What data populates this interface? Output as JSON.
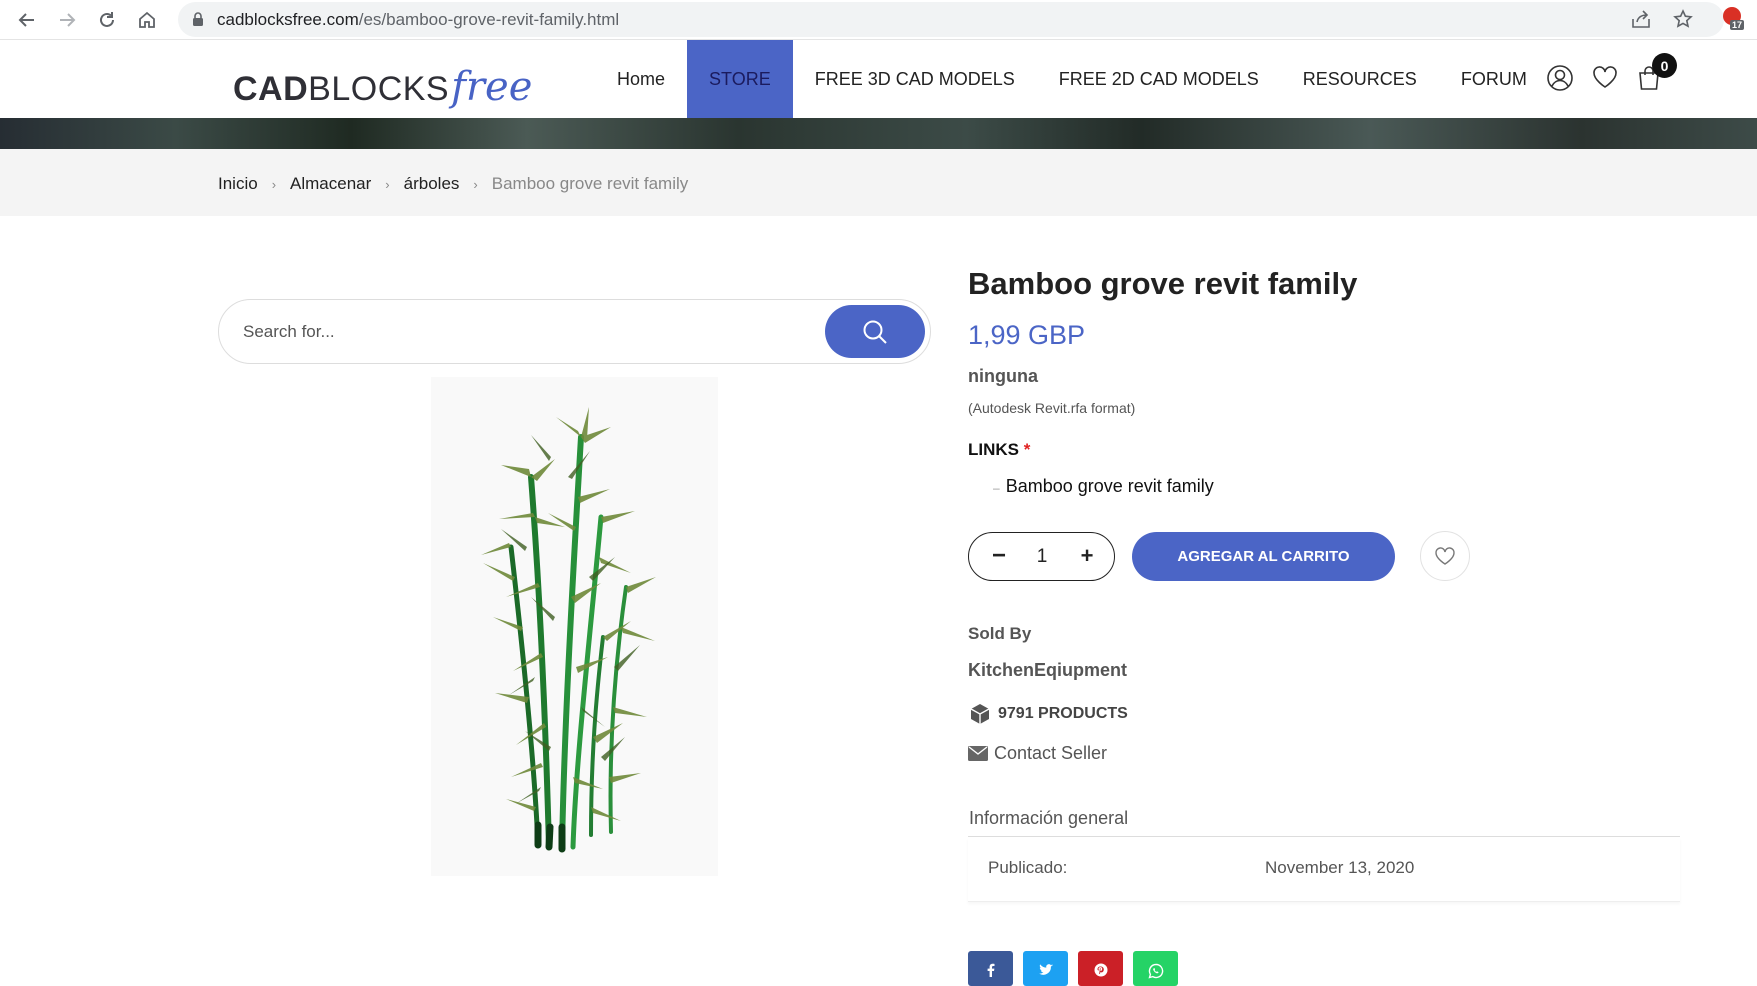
{
  "browser": {
    "url_host": "cadblocksfree.com",
    "url_path": "/es/bamboo-grove-revit-family.html",
    "extension_badge": "17"
  },
  "header": {
    "logo": {
      "bold": "CAD",
      "light": "BLOCKS",
      "script": "free"
    },
    "nav": [
      {
        "label": "Home"
      },
      {
        "label": "STORE"
      },
      {
        "label": "FREE 3D CAD MODELS"
      },
      {
        "label": "FREE 2D CAD MODELS"
      },
      {
        "label": "RESOURCES"
      },
      {
        "label": "FORUM"
      }
    ],
    "cart_count": "0"
  },
  "breadcrumb": {
    "items": [
      "Inicio",
      "Almacenar",
      "árboles"
    ],
    "current": "Bamboo grove revit family"
  },
  "search": {
    "placeholder": "Search for..."
  },
  "product": {
    "title": "Bamboo grove revit family",
    "price": "1,99 GBP",
    "brand": "ninguna",
    "format": "(Autodesk Revit.rfa format)",
    "links_label": "LINKS",
    "links_required": "*",
    "link_option": "Bamboo grove revit family",
    "quantity": "1",
    "add_to_cart": "AGREGAR AL CARRITO"
  },
  "seller": {
    "sold_by_label": "Sold By",
    "name": "KitchenEqiupment",
    "products": "9791 PRODUCTS",
    "contact": "Contact Seller"
  },
  "info": {
    "tab": "Información general",
    "rows": [
      {
        "key": "Publicado:",
        "value": "November 13, 2020"
      }
    ]
  },
  "share_colors": {
    "facebook": "#3b5998",
    "twitter": "#1da1f2",
    "pinterest": "#cb2027",
    "whatsapp": "#25d366"
  },
  "accent_color": "#4b65c6"
}
